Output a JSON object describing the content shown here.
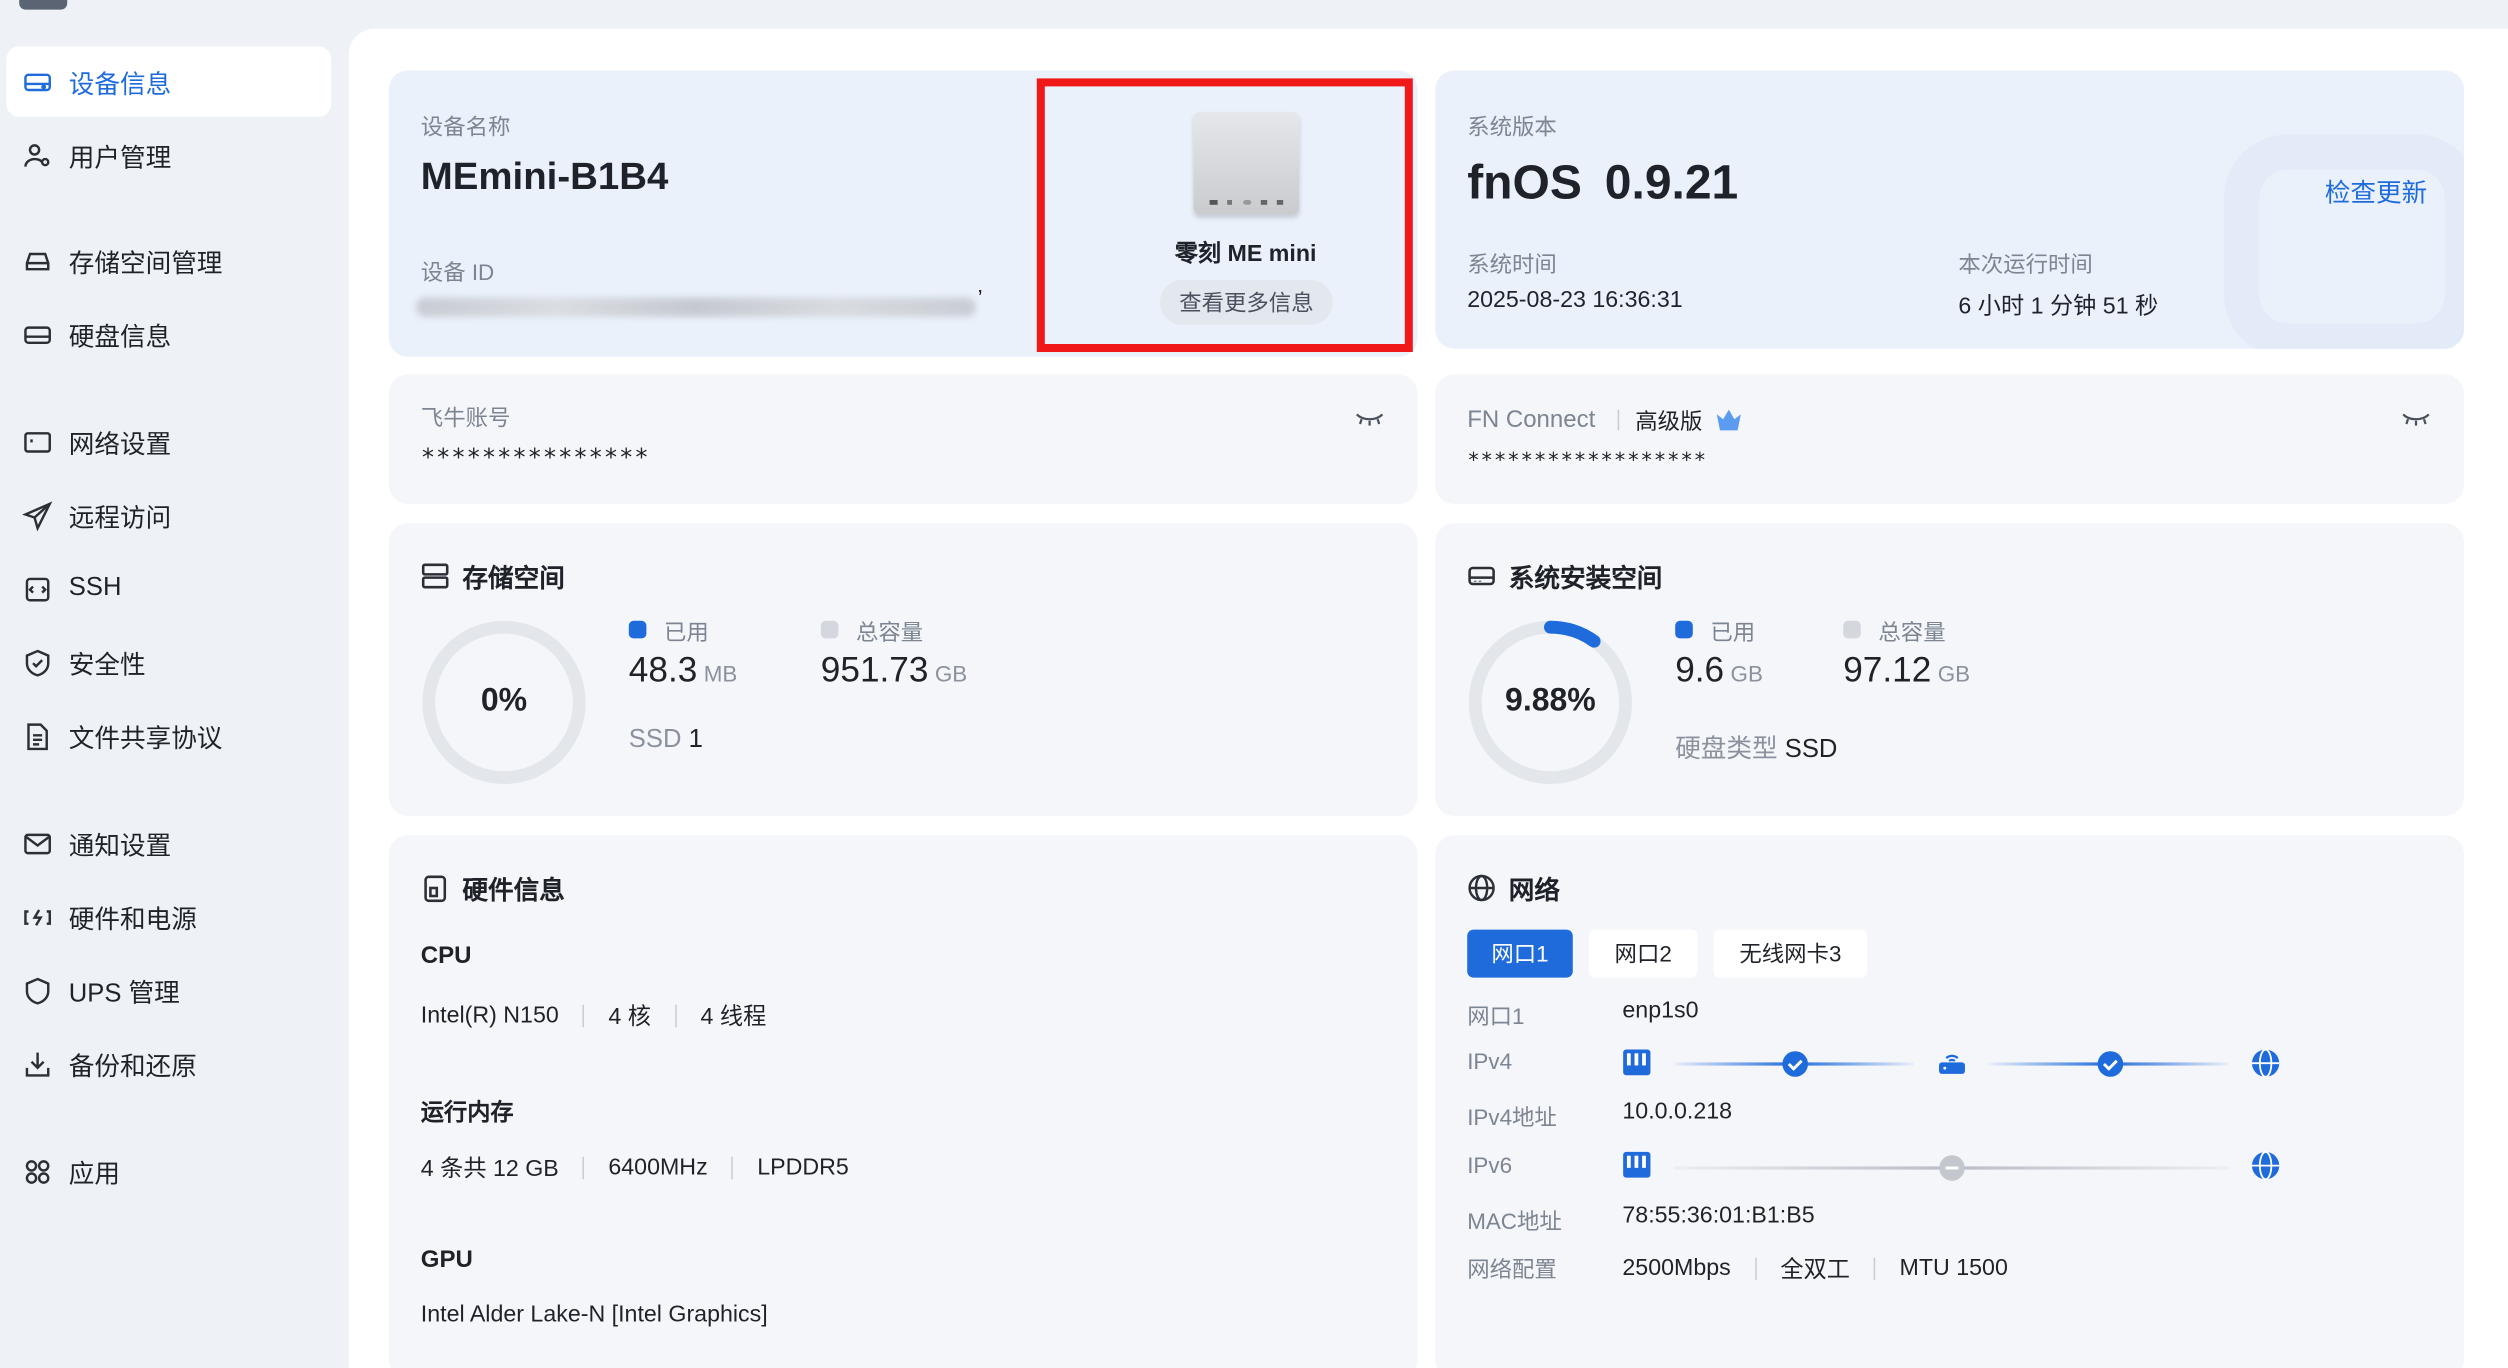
{
  "sidebar": {
    "items": [
      {
        "label": "设备信息",
        "icon": "device-icon"
      },
      {
        "label": "用户管理",
        "icon": "users-icon"
      },
      {
        "label": "存储空间管理",
        "icon": "storage-icon"
      },
      {
        "label": "硬盘信息",
        "icon": "disk-icon"
      },
      {
        "label": "网络设置",
        "icon": "network-icon"
      },
      {
        "label": "远程访问",
        "icon": "send-icon"
      },
      {
        "label": "SSH",
        "icon": "terminal-icon"
      },
      {
        "label": "安全性",
        "icon": "shield-icon"
      },
      {
        "label": "文件共享协议",
        "icon": "file-icon"
      },
      {
        "label": "通知设置",
        "icon": "mail-icon"
      },
      {
        "label": "硬件和电源",
        "icon": "power-icon"
      },
      {
        "label": "UPS 管理",
        "icon": "ups-shield-icon"
      },
      {
        "label": "备份和还原",
        "icon": "backup-icon"
      },
      {
        "label": "应用",
        "icon": "apps-icon"
      }
    ]
  },
  "device": {
    "name_label": "设备名称",
    "name": "MEmini-B1B4",
    "id_label": "设备 ID",
    "id_trailing": "’",
    "model": "零刻 ME mini",
    "more_button": "查看更多信息"
  },
  "system": {
    "version_label": "系统版本",
    "os": "fnOS",
    "version": "0.9.21",
    "check_update": "检查更新",
    "time_label": "系统时间",
    "time": "2025-08-23 16:36:31",
    "uptime_label": "本次运行时间",
    "uptime": "6 小时 1 分钟 51 秒"
  },
  "account": {
    "label": "飞牛账号",
    "value": "***************"
  },
  "connect": {
    "label": "FN Connect",
    "tier": "高级版",
    "value": "******************"
  },
  "storage": {
    "title": "存储空间",
    "percent": "0%",
    "percent_value": 0.0,
    "used_label": "已用",
    "used": "48.3",
    "used_unit": "MB",
    "total_label": "总容量",
    "total": "951.73",
    "total_unit": "GB",
    "ssd_label": "SSD",
    "ssd_count": "1"
  },
  "sysspace": {
    "title": "系统安装空间",
    "percent": "9.88%",
    "percent_value": 0.0988,
    "used_label": "已用",
    "used": "9.6",
    "used_unit": "GB",
    "total_label": "总容量",
    "total": "97.12",
    "total_unit": "GB",
    "disk_type_label": "硬盘类型",
    "disk_type": "SSD"
  },
  "hardware": {
    "title": "硬件信息",
    "cpu_label": "CPU",
    "cpu_model": "Intel(R) N150",
    "cpu_cores": "4 核",
    "cpu_threads": "4 线程",
    "mem_label": "运行内存",
    "mem_size": "4 条共 12 GB",
    "mem_speed": "6400MHz",
    "mem_type": "LPDDR5",
    "gpu_label": "GPU",
    "gpu_model": "Intel Alder Lake-N [Intel Graphics]"
  },
  "network": {
    "title": "网络",
    "tabs": [
      "网口1",
      "网口2",
      "无线网卡3"
    ],
    "port_label": "网口1",
    "port_value": "enp1s0",
    "ipv4_label": "IPv4",
    "ipv4addr_label": "IPv4地址",
    "ipv4addr": "10.0.0.218",
    "ipv6_label": "IPv6",
    "mac_label": "MAC地址",
    "mac": "78:55:36:01:B1:B5",
    "config_label": "网络配置",
    "speed": "2500Mbps",
    "duplex": "全双工",
    "mtu": "MTU 1500"
  },
  "colors": {
    "accent": "#1f6bdc",
    "highlight_box": "#f01818",
    "donut_track": "#e3e6eb"
  }
}
